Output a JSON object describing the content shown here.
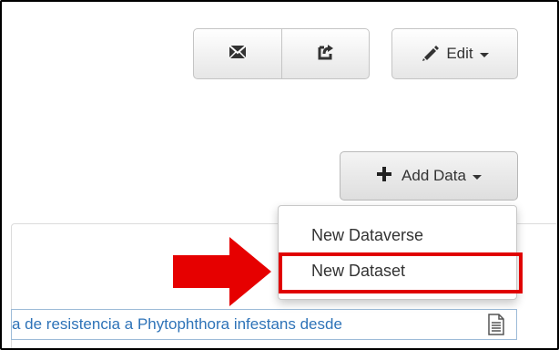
{
  "toolbar": {
    "email_icon": "envelope-icon",
    "share_icon": "share-icon",
    "edit_label": "Edit",
    "edit_icon": "pencil-icon",
    "add_data_label": "Add Data",
    "add_data_icon": "plus-icon"
  },
  "add_data_menu": {
    "items": [
      {
        "label": "New Dataverse"
      },
      {
        "label": "New Dataset"
      }
    ],
    "highlighted_item": "New Dataset"
  },
  "content": {
    "row_text": "a de resistencia a Phytophthora infestans desde",
    "row_icon": "document-icon"
  },
  "colors": {
    "highlight_border": "#e00000",
    "arrow_fill": "#e60000",
    "link_text": "#2e73b8"
  }
}
